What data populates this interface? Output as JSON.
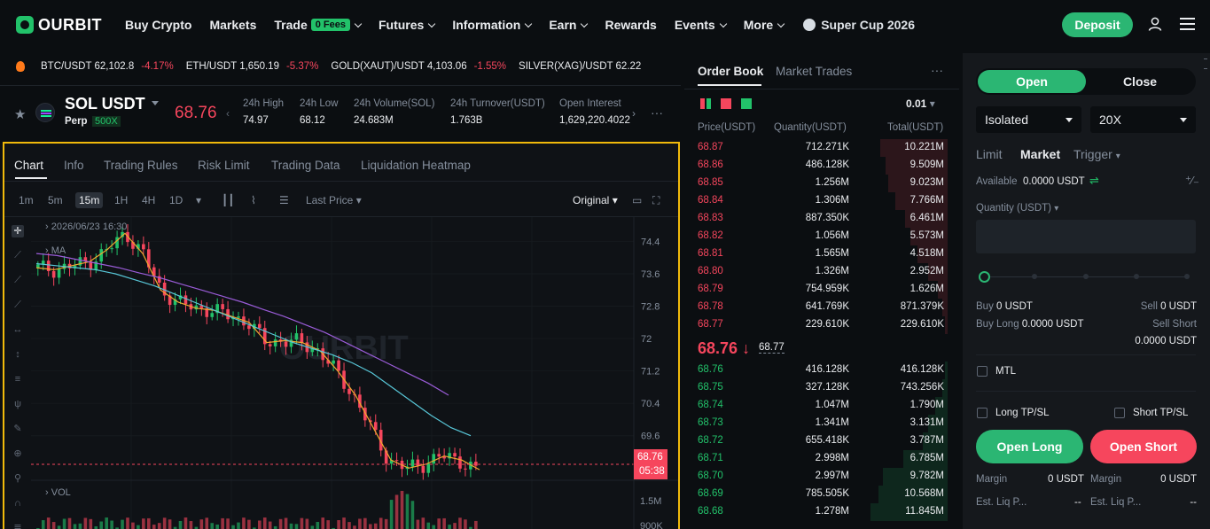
{
  "nav": {
    "logo": "OURBIT",
    "items": [
      {
        "label": "Buy Crypto",
        "chevron": false
      },
      {
        "label": "Markets",
        "chevron": false
      },
      {
        "label": "Trade",
        "chevron": true,
        "badge": "0 Fees"
      },
      {
        "label": "Futures",
        "chevron": true
      },
      {
        "label": "Information",
        "chevron": true
      },
      {
        "label": "Earn",
        "chevron": true
      },
      {
        "label": "Rewards",
        "chevron": false
      },
      {
        "label": "Events",
        "chevron": true
      },
      {
        "label": "More",
        "chevron": true
      }
    ],
    "promo": "Super Cup 2026",
    "deposit": "Deposit"
  },
  "ticker": [
    {
      "pair": "BTC/USDT",
      "price": "62,102.8",
      "change": "-4.17%"
    },
    {
      "pair": "ETH/USDT",
      "price": "1,650.19",
      "change": "-5.37%"
    },
    {
      "pair": "GOLD(XAUT)/USDT",
      "price": "4,103.06",
      "change": "-1.55%"
    },
    {
      "pair": "SILVER(XAG)/USDT",
      "price": "62.22",
      "change": ""
    }
  ],
  "symbol": {
    "name": "SOL USDT",
    "type": "Perp",
    "leverage": "500X",
    "price": "68.76",
    "stats": [
      {
        "label": "24h High",
        "value": "74.97"
      },
      {
        "label": "24h Low",
        "value": "68.12"
      },
      {
        "label": "24h Volume(SOL)",
        "value": "24.683M"
      },
      {
        "label": "24h Turnover(USDT)",
        "value": "1.763B"
      },
      {
        "label": "Open Interest",
        "value": "1,629,220.4022"
      }
    ]
  },
  "chart_panel": {
    "tabs": [
      "Chart",
      "Info",
      "Trading Rules",
      "Risk Limit",
      "Trading Data",
      "Liquidation Heatmap"
    ],
    "intervals": [
      "1m",
      "5m",
      "15m",
      "1H",
      "4H",
      "1D"
    ],
    "selected_interval": "15m",
    "price_type": "Last Price",
    "view_mode": "Original",
    "timestamp": "2026/06/23 16:30",
    "ma_label": "MA",
    "vol_label": "VOL",
    "watermark": "OURBIT",
    "price_axis": [
      "74.4",
      "73.6",
      "72.8",
      "72",
      "71.2",
      "70.4",
      "69.6"
    ],
    "vol_axis": [
      "1.5M",
      "900K"
    ],
    "last_price_tag": "68.76",
    "countdown": "05:38"
  },
  "chart_data": {
    "type": "line",
    "title": "",
    "symbol": "SOL USDT",
    "interval": "15m",
    "ylim": [
      68.5,
      75
    ],
    "series": [
      {
        "name": "",
        "values": [
          73.75,
          73.7,
          73.8,
          73.9,
          74.2,
          74.6,
          74.1,
          73.2,
          72.9,
          72.75,
          72.7,
          72.55,
          72.4,
          71.9,
          71.95,
          71.9,
          71.7,
          71.2,
          70.6,
          69.8,
          69.0,
          68.8,
          68.9,
          69.1,
          69.0,
          68.76
        ]
      },
      {
        "name": "",
        "values": [
          73.85,
          73.8,
          73.75,
          73.7,
          73.6,
          73.45,
          73.3,
          73.1,
          72.9,
          72.7,
          72.5,
          72.3,
          72.1,
          71.9,
          71.75,
          71.6,
          71.4,
          71.15,
          70.8,
          70.45,
          70.1,
          69.8,
          69.6
        ]
      },
      {
        "name": "",
        "values": [
          74.1,
          74.05,
          73.95,
          73.85,
          73.75,
          73.62,
          73.5,
          73.35,
          73.2,
          73.05,
          72.9,
          72.72,
          72.55,
          72.35,
          72.15,
          71.9,
          71.65,
          71.4,
          71.15,
          70.9,
          70.6
        ]
      }
    ]
  },
  "orderbook": {
    "tabs": [
      "Order Book",
      "Market Trades"
    ],
    "precision": "0.01",
    "headers": [
      "Price(USDT)",
      "Quantity(USDT)",
      "Total(USDT)"
    ],
    "asks": [
      {
        "price": "68.87",
        "qty": "712.271K",
        "total": "10.221M",
        "depth": 0.27
      },
      {
        "price": "68.86",
        "qty": "486.128K",
        "total": "9.509M",
        "depth": 0.25
      },
      {
        "price": "68.85",
        "qty": "1.256M",
        "total": "9.023M",
        "depth": 0.24
      },
      {
        "price": "68.84",
        "qty": "1.306M",
        "total": "7.766M",
        "depth": 0.21
      },
      {
        "price": "68.83",
        "qty": "887.350K",
        "total": "6.461M",
        "depth": 0.17
      },
      {
        "price": "68.82",
        "qty": "1.056M",
        "total": "5.573M",
        "depth": 0.15
      },
      {
        "price": "68.81",
        "qty": "1.565M",
        "total": "4.518M",
        "depth": 0.12
      },
      {
        "price": "68.80",
        "qty": "1.326M",
        "total": "2.952M",
        "depth": 0.08
      },
      {
        "price": "68.79",
        "qty": "754.959K",
        "total": "1.626M",
        "depth": 0.04
      },
      {
        "price": "68.78",
        "qty": "641.769K",
        "total": "871.379K",
        "depth": 0.02
      },
      {
        "price": "68.77",
        "qty": "229.610K",
        "total": "229.610K",
        "depth": 0.01
      }
    ],
    "mid_price": "68.76",
    "mark_price": "68.77",
    "bids": [
      {
        "price": "68.76",
        "qty": "416.128K",
        "total": "416.128K",
        "depth": 0.01
      },
      {
        "price": "68.75",
        "qty": "327.128K",
        "total": "743.256K",
        "depth": 0.02
      },
      {
        "price": "68.74",
        "qty": "1.047M",
        "total": "1.790M",
        "depth": 0.05
      },
      {
        "price": "68.73",
        "qty": "1.341M",
        "total": "3.131M",
        "depth": 0.08
      },
      {
        "price": "68.72",
        "qty": "655.418K",
        "total": "3.787M",
        "depth": 0.1
      },
      {
        "price": "68.71",
        "qty": "2.998M",
        "total": "6.785M",
        "depth": 0.18
      },
      {
        "price": "68.70",
        "qty": "2.997M",
        "total": "9.782M",
        "depth": 0.26
      },
      {
        "price": "68.69",
        "qty": "785.505K",
        "total": "10.568M",
        "depth": 0.28
      },
      {
        "price": "68.68",
        "qty": "1.278M",
        "total": "11.845M",
        "depth": 0.31
      }
    ]
  },
  "trade": {
    "open": "Open",
    "close": "Close",
    "margin_mode": "Isolated",
    "leverage": "20X",
    "order_types": [
      "Limit",
      "Market",
      "Trigger"
    ],
    "selected_order_type": "Market",
    "available_label": "Available",
    "available_value": "0.0000 USDT",
    "quantity_label": "Quantity (USDT)",
    "buy_label": "Buy",
    "buy_value": "0 USDT",
    "sell_label": "Sell",
    "sell_value": "0 USDT",
    "buy_long_label": "Buy Long",
    "buy_long_value": "0.0000 USDT",
    "sell_short_label": "Sell Short",
    "sell_short_value": "0.0000 USDT",
    "mtl": "MTL",
    "long_tpsl": "Long TP/SL",
    "short_tpsl": "Short TP/SL",
    "open_long": "Open Long",
    "open_short": "Open Short",
    "margin_label": "Margin",
    "margin_long": "0 USDT",
    "margin_short": "0 USDT",
    "liq_label": "Est. Liq P...",
    "liq_long": "--",
    "liq_short": "--"
  }
}
